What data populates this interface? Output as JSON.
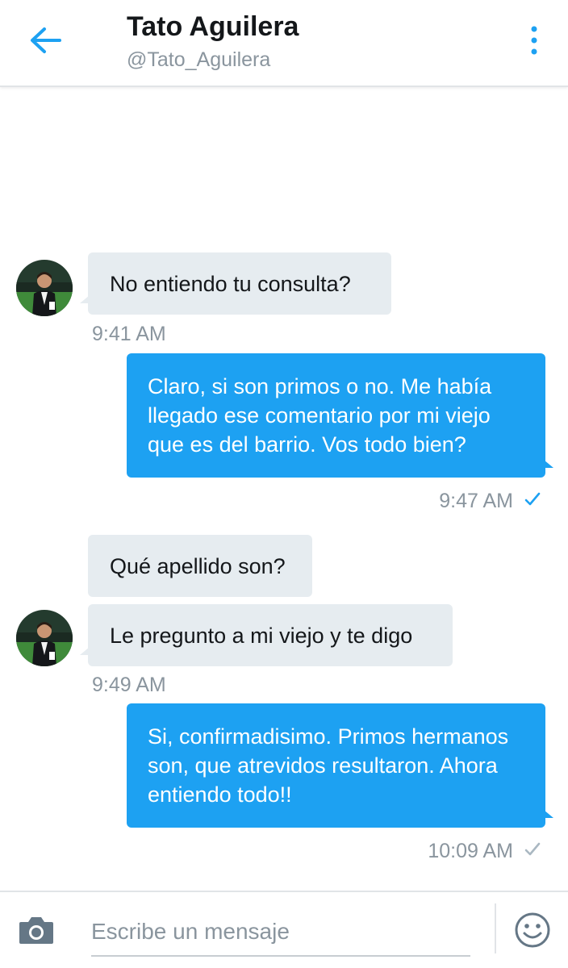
{
  "header": {
    "name": "Tato Aguilera",
    "handle": "@Tato_Aguilera",
    "back_icon": "arrow-left-icon",
    "more_icon": "more-vertical-icon",
    "accent_color": "#1da1f2"
  },
  "messages": [
    {
      "direction": "incoming",
      "text": "No entiendo tu consulta?"
    },
    {
      "direction": "outgoing",
      "text": "Claro, si son primos o no. Me había llegado ese comentario por mi viejo que  es del barrio. Vos todo bien?"
    },
    {
      "direction": "incoming",
      "text": "Qué apellido son?"
    },
    {
      "direction": "incoming",
      "text": "Le pregunto a mi viejo y te digo"
    },
    {
      "direction": "outgoing",
      "text": "Si, confirmadisimo. Primos hermanos son, que atrevidos resultaron. Ahora entiendo todo!!"
    }
  ],
  "timestamps": {
    "t1": "9:41 AM",
    "t2": "9:47 AM",
    "t3": "9:49 AM",
    "t4": "10:09 AM"
  },
  "read_receipts": {
    "t2": {
      "icon": "check-icon",
      "color": "#1da1f2"
    },
    "t4": {
      "icon": "check-icon",
      "color": "#aab8c2"
    }
  },
  "composer": {
    "placeholder": "Escribe un mensaje",
    "camera_icon": "camera-icon",
    "emoji_icon": "emoji-icon"
  },
  "colors": {
    "incoming_bubble": "#e6ecf0",
    "outgoing_bubble": "#1da1f2",
    "secondary_text": "#8a959e"
  }
}
